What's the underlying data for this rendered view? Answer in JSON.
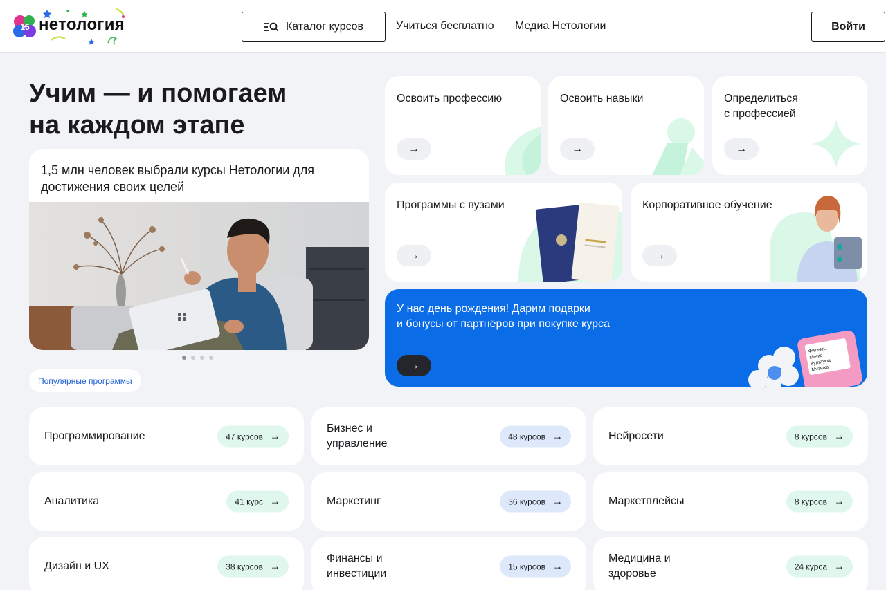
{
  "header": {
    "logo_text": "нетология",
    "logo_badge": "15",
    "catalog_label": "Каталог курсов",
    "nav": [
      "Учиться бесплатно",
      "Медиа Нетологии"
    ],
    "login_label": "Войти"
  },
  "hero": {
    "title_line1": "Учим — и помогаем",
    "title_line2": "на каждом этапе",
    "slider_text": "1,5 млн человек выбрали курсы Нетологии для достижения своих целей",
    "slider_count": 4,
    "slider_active": 1,
    "popular_label": "Популярные программы"
  },
  "features": {
    "profession": "Освоить профессию",
    "skills": "Освоить навыки",
    "define_line1": "Определиться",
    "define_line2": "с профессией",
    "universities": "Программы с вузами",
    "corporate": "Корпоративное обучение",
    "arrow": "→"
  },
  "promo": {
    "line1": "У нас день рождения! Дарим подарки",
    "line2": "и бонусы от партнёров при покупке курса",
    "device_lines": [
      "Фильмы",
      "Меню",
      "Культура",
      "Музыка"
    ]
  },
  "categories": [
    {
      "name": "Программирование",
      "count": "47 курсов",
      "color": "#dff7ec"
    },
    {
      "name": "Бизнес и управление",
      "count": "48 курсов",
      "color": "#dde9fb"
    },
    {
      "name": "Нейросети",
      "count": "8 курсов",
      "color": "#dff7ec"
    },
    {
      "name": "Аналитика",
      "count": "41 курс",
      "color": "#dff7ec"
    },
    {
      "name": "Маркетинг",
      "count": "36 курсов",
      "color": "#dde9fb"
    },
    {
      "name": "Маркетплейсы",
      "count": "8 курсов",
      "color": "#dff7ec"
    },
    {
      "name": "Дизайн и UX",
      "count": "38 курсов",
      "color": "#dff7ec"
    },
    {
      "name": "Финансы и инвестиции",
      "count": "15 курсов",
      "color": "#dde9fb"
    },
    {
      "name": "Медицина и здоровье",
      "count": "24 курса",
      "color": "#dff7ec"
    }
  ],
  "colors": {
    "accent_blue": "#0a6ce6",
    "mint": "#d9f8e7",
    "link_blue": "#1f5fd6"
  }
}
